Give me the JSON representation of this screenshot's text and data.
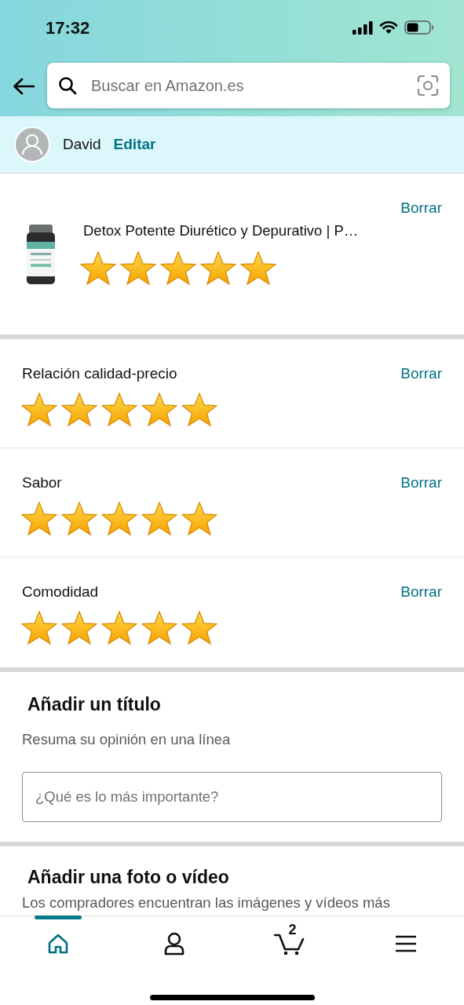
{
  "status_bar": {
    "time": "17:32"
  },
  "search": {
    "placeholder": "Buscar en Amazon.es"
  },
  "user": {
    "name": "David",
    "edit_link": "Editar"
  },
  "product": {
    "title": "Detox Potente Diurético y Depurativo | P…",
    "stars": 5,
    "delete_link": "Borrar"
  },
  "criteria": [
    {
      "label": "Relación calidad-precio",
      "stars": 5,
      "delete_link": "Borrar"
    },
    {
      "label": "Sabor",
      "stars": 5,
      "delete_link": "Borrar"
    },
    {
      "label": "Comodidad",
      "stars": 5,
      "delete_link": "Borrar"
    }
  ],
  "title_section": {
    "heading": "Añadir un título",
    "hint": "Resuma su opinión en una línea",
    "placeholder": "¿Qué es lo más importante?"
  },
  "photo_section": {
    "heading": "Añadir una foto o vídeo",
    "text": "Los compradores encuentran las imágenes y vídeos más"
  },
  "bottom_nav": [
    {
      "kind": "home",
      "selected": true
    },
    {
      "kind": "account",
      "selected": false
    },
    {
      "kind": "cart",
      "badge": "2",
      "selected": false
    },
    {
      "kind": "menu",
      "selected": false
    }
  ]
}
